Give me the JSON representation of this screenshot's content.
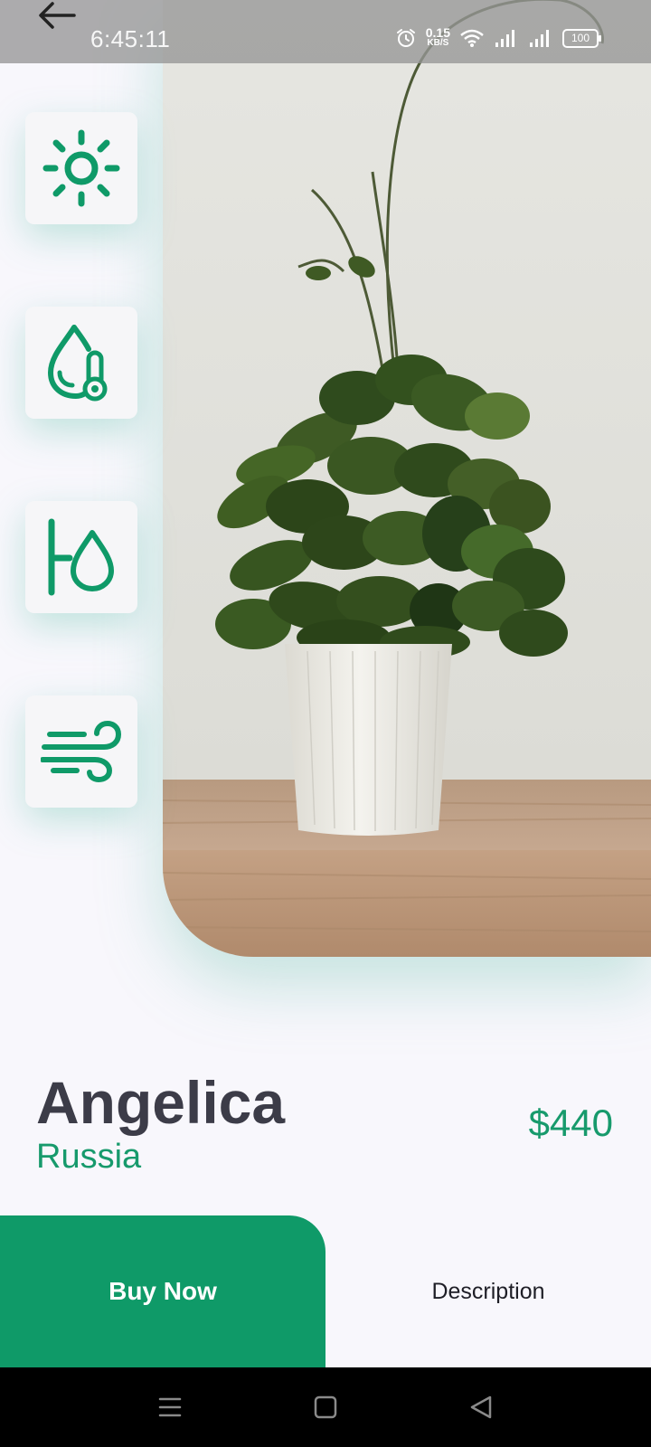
{
  "status_bar": {
    "time": "6:45:11",
    "net_speed_value": "0.15",
    "net_speed_unit": "KB/S",
    "battery": "100"
  },
  "side_icons": [
    "sun-icon",
    "humidity-temperature-icon",
    "watering-icon",
    "wind-icon"
  ],
  "product": {
    "name": "Angelica",
    "origin": "Russia",
    "price": "$440"
  },
  "actions": {
    "buy_label": "Buy Now",
    "description_label": "Description"
  },
  "colors": {
    "accent": "#0f9a68",
    "title": "#3c3c48",
    "background": "#f8f7fc"
  }
}
